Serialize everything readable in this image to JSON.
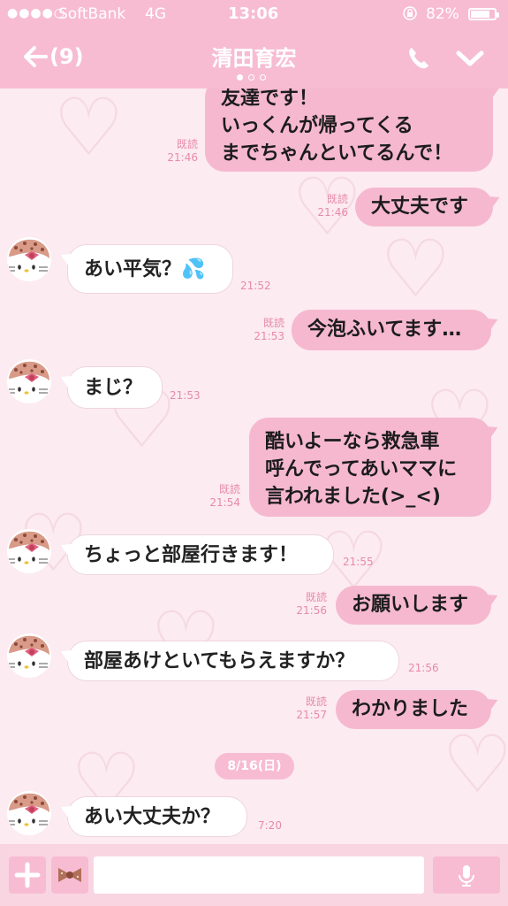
{
  "status_bar": {
    "signal": "●●●●○",
    "carrier": "SoftBank",
    "network": "4G",
    "time": "13:06",
    "battery_text": "82%",
    "battery_level": 0.82
  },
  "header": {
    "back_label": "(9)",
    "title": "清田育宏",
    "page_dots_active_index": 0
  },
  "messages": [
    {
      "side": "mine",
      "text": "友達です！\nいっくんが帰ってくる\nまでちゃんといてるんで！",
      "read": "既読",
      "time": "21:46"
    },
    {
      "side": "mine",
      "text": "大丈夫です",
      "read": "既読",
      "time": "21:46"
    },
    {
      "side": "theirs",
      "text": "あい平気？💦",
      "time": "21:52"
    },
    {
      "side": "mine",
      "text": "今泡ふいてます…",
      "read": "既読",
      "time": "21:53"
    },
    {
      "side": "theirs",
      "text": "まじ？",
      "time": "21:53"
    },
    {
      "side": "mine",
      "text": "酷いよーなら救急車\n呼んでってあいママに\n言われました(>_<)",
      "read": "既読",
      "time": "21:54"
    },
    {
      "side": "theirs",
      "text": "ちょっと部屋行きます！",
      "time": "21:55"
    },
    {
      "side": "mine",
      "text": "お願いします",
      "read": "既読",
      "time": "21:56"
    },
    {
      "side": "theirs",
      "text": "部屋あけといてもらえますか？",
      "time": "21:56"
    },
    {
      "side": "mine",
      "text": "わかりました",
      "read": "既読",
      "time": "21:57"
    },
    {
      "side": "theirs",
      "text": "あい大丈夫か？",
      "time": "7:20"
    }
  ],
  "date_separator": "8/16(日)",
  "colors": {
    "header": "#f7bcd2",
    "my_bubble": "#f6b8cf",
    "their_bubble": "#ffffff",
    "meta_text": "#e78aa9",
    "background": "#fcebf1"
  },
  "icons": {
    "back": "arrow-left-icon",
    "call": "phone-icon",
    "menu": "chevron-down-icon",
    "add": "plus-icon",
    "sticker": "ribbon-sticker-icon",
    "voice": "microphone-icon",
    "avatar": "kitty-avatar-icon"
  }
}
